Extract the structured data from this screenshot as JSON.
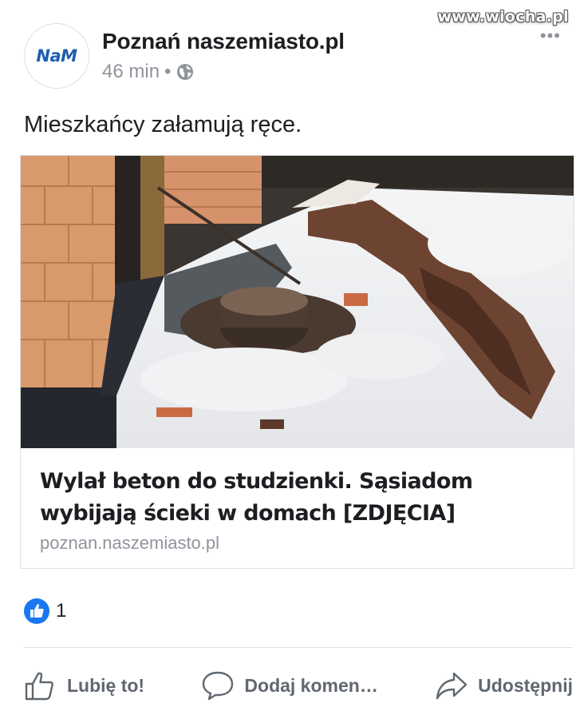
{
  "watermark": "www.wiocha.pl",
  "post": {
    "page_name": "Poznań naszemiasto.pl",
    "avatar_text": "NaM",
    "time": "46 min",
    "separator": "•",
    "privacy_icon": "globe-icon",
    "text": "Mieszkańcy załamują ręce."
  },
  "link": {
    "title_line1": "Wylał beton do studzienki. Sąsiadom",
    "title_line2": "wybijają ścieki w domach [ZDJĘCIA]",
    "domain": "poznan.naszemiasto.pl",
    "image_description": "snow-covered-trench-with-manhole"
  },
  "reactions": {
    "icon": "thumbs-up-icon",
    "count": "1"
  },
  "actions": {
    "like": "Lubię to!",
    "comment": "Dodaj komen…",
    "share": "Udostępnij"
  },
  "colors": {
    "text": "#1c1e21",
    "secondary": "#90949c",
    "action": "#606770",
    "like_blue": "#1877f2",
    "brand_blue": "#1d5fb1"
  }
}
